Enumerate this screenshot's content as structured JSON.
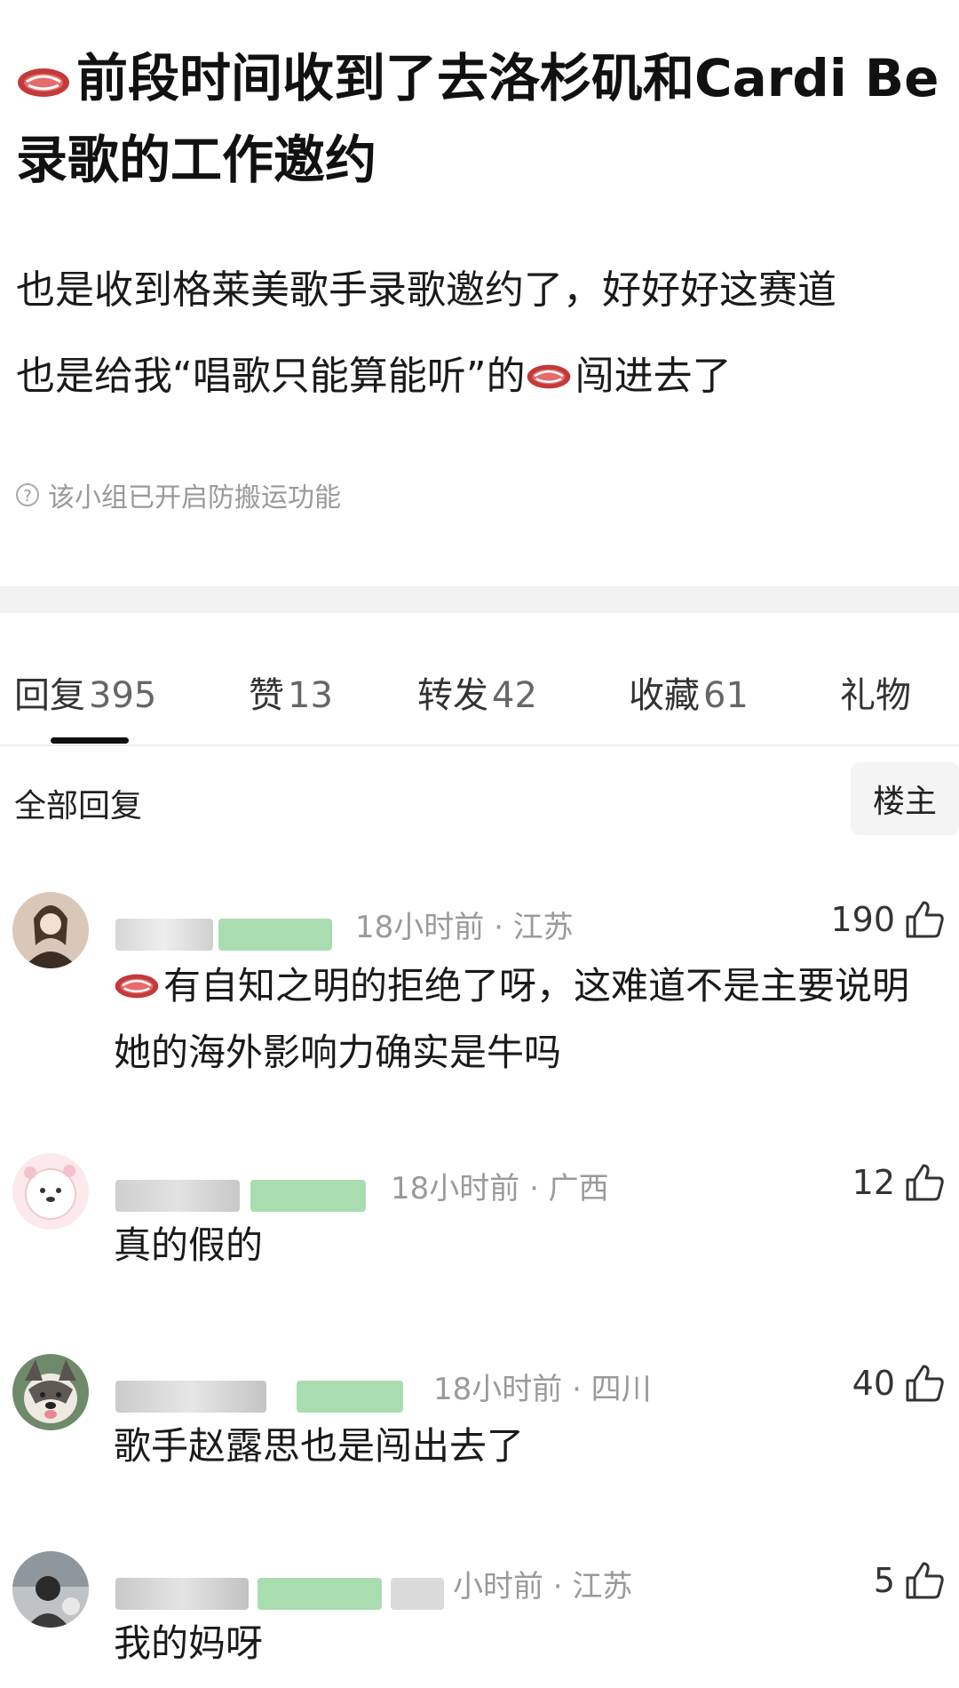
{
  "post": {
    "title": "前段时间收到了去洛杉矶和Cardi Be录歌的工作邀约",
    "body_line1": "也是收到格莱美歌手录歌邀约了，好好好这赛道",
    "body_line2_a": "也是给我“唱歌只能算能听”的",
    "body_line2_b": "闯进去了",
    "notice": "该小组已开启防搬运功能"
  },
  "tabs": [
    {
      "label": "回复",
      "count": "395"
    },
    {
      "label": "赞",
      "count": "13"
    },
    {
      "label": "转发",
      "count": "42"
    },
    {
      "label": "收藏",
      "count": "61"
    },
    {
      "label": "礼物",
      "count": ""
    }
  ],
  "replies_header": {
    "label": "全部回复",
    "filter_button": "楼主"
  },
  "comments": [
    {
      "meta": "18小时前 · 江苏",
      "likes": "190",
      "text": "有自知之明的拒绝了呀，这难道不是主要说明她的海外影响力确实是牛吗"
    },
    {
      "meta": "18小时前 · 广西",
      "likes": "12",
      "text": "真的假的"
    },
    {
      "meta": "18小时前 · 四川",
      "likes": "40",
      "text": "歌手赵露思也是闯出去了"
    },
    {
      "meta": "小时前 · 江苏",
      "likes": "5",
      "text": "我的妈呀"
    }
  ],
  "colors": {
    "tag_green": "#7fcf8a",
    "meta_gray": "#9a9a9a",
    "steak_red": "#c23a3a"
  }
}
